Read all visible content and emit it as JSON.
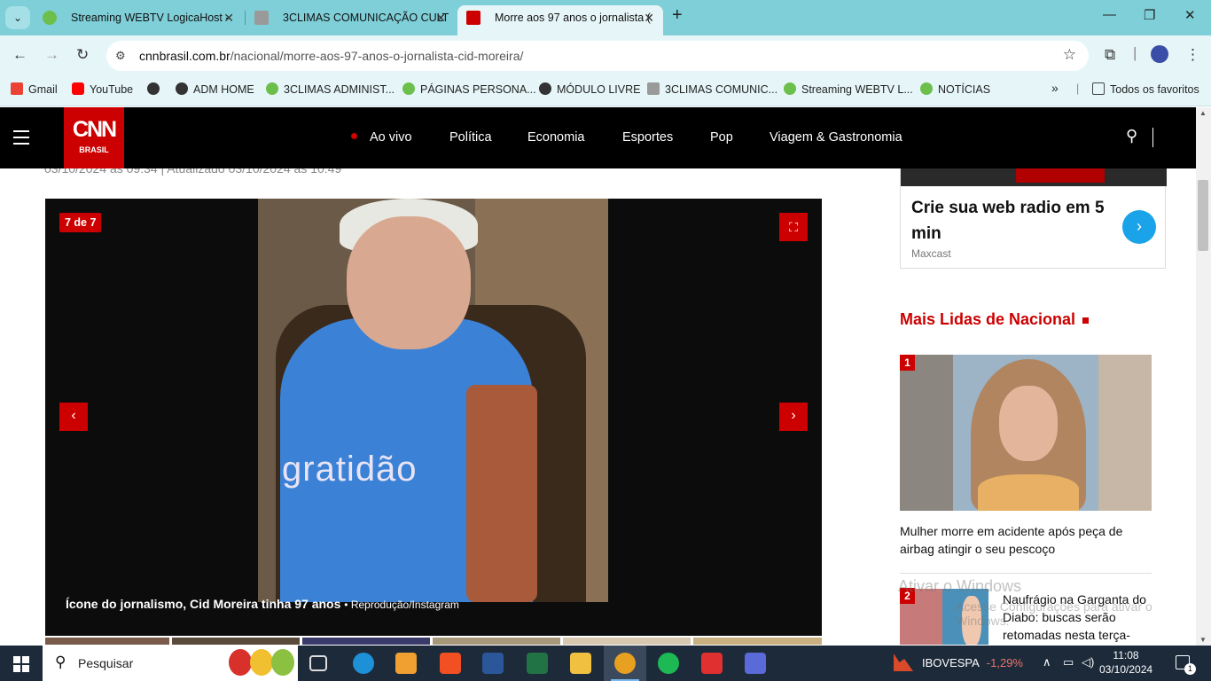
{
  "browser": {
    "tabs": [
      {
        "title": "Streaming WEBTV LogicaHost -",
        "favicon_color": "#4caf50"
      },
      {
        "title": "3CLIMAS COMUNICAÇÃO CULT",
        "favicon_color": "#8a8a8a"
      },
      {
        "title": "Morre aos 97 anos o jornalista (",
        "favicon_color": "#cc0000",
        "active": true
      }
    ],
    "url_domain": "cnnbrasil.com.br",
    "url_path": "/nacional/morre-aos-97-anos-o-jornalista-cid-moreira/",
    "bookmarks": [
      {
        "label": "Gmail",
        "icon": "gmail-icon"
      },
      {
        "label": "YouTube",
        "icon": "youtube-icon"
      },
      {
        "label": "",
        "icon": "globe-icon"
      },
      {
        "label": "ADM HOME",
        "icon": "globe-icon"
      },
      {
        "label": "3CLIMAS ADMINIST...",
        "icon": "site-icon"
      },
      {
        "label": "PÁGINAS PERSONA...",
        "icon": "site-icon"
      },
      {
        "label": "MÓDULO LIVRE",
        "icon": "globe-icon"
      },
      {
        "label": "3CLIMAS COMUNIC...",
        "icon": "site-icon"
      },
      {
        "label": "Streaming WEBTV L...",
        "icon": "site-icon"
      },
      {
        "label": "NOTÍCIAS",
        "icon": "site-icon"
      }
    ],
    "all_bookmarks": "Todos os favoritos"
  },
  "cnn": {
    "logo_text": "CNN",
    "logo_sub": "BRASIL",
    "nav": [
      "Ao vivo",
      "Política",
      "Economia",
      "Esportes",
      "Pop",
      "Viagem & Gastronomia"
    ],
    "accent": "#cc0000"
  },
  "article": {
    "dateline": "03/10/2024 às 09:34 | Atualizado 03/10/2024 às 10:49",
    "gallery": {
      "counter": "7 de 7",
      "shirt_text": "gratidão",
      "caption": "Ícone do jornalismo, Cid Moreira tinha 97 anos",
      "credit": "Reprodução/Instagram"
    }
  },
  "sidebar": {
    "ad": {
      "title": "Crie sua web radio em 5 min",
      "source": "Maxcast"
    },
    "mais_lidas_title": "Mais Lidas de Nacional",
    "news": [
      {
        "rank": "1",
        "title": "Mulher morre em acidente após peça de airbag atingir o seu pescoço"
      },
      {
        "rank": "2",
        "title": "Naufrágio na Garganta do Diabo: buscas serão retomadas nesta terça-"
      }
    ]
  },
  "overlay": {
    "watermark_title": "Ativar o Windows",
    "watermark_sub": "Acesse Configurações para ativar o Windows."
  },
  "taskbar": {
    "search_placeholder": "Pesquisar",
    "ticker_name": "IBOVESPA",
    "ticker_change": "-1,29%",
    "time": "11:08",
    "date": "03/10/2024",
    "notifications": "1"
  }
}
